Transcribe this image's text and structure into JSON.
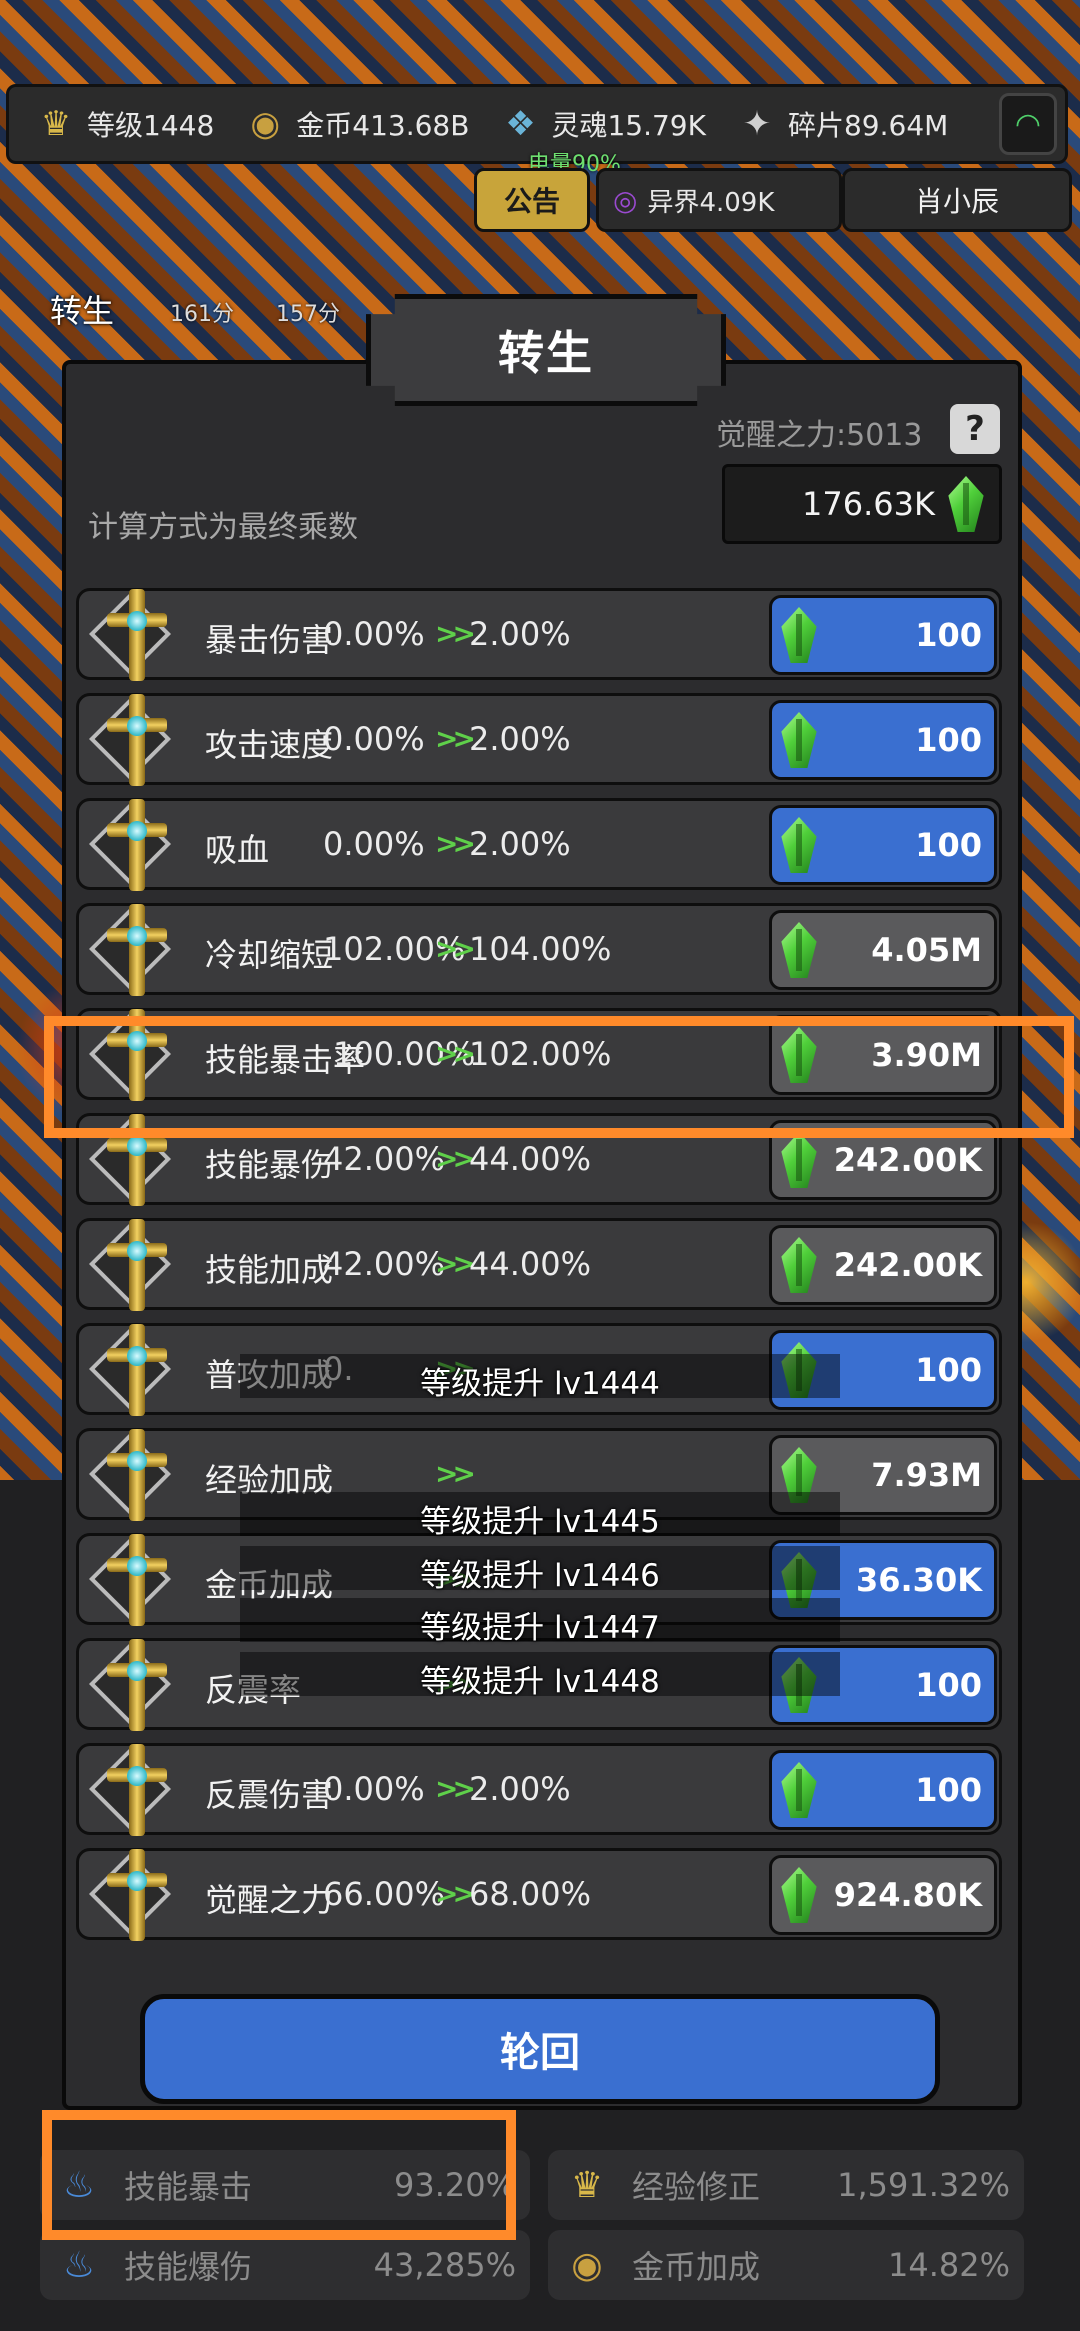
{
  "topbar": {
    "level": "等级1448",
    "gold": "金币413.68B",
    "soul": "灵魂15.79K",
    "shard": "碎片89.64M"
  },
  "battery": "电量90%",
  "notice_label": "公告",
  "otherworld": "异界4.09K",
  "player_name": "肖小辰",
  "side_label": "转生",
  "time_a": "161分",
  "time_b": "157分",
  "panel": {
    "title": "转生",
    "awaken_power": "觉醒之力:5013",
    "help": "?",
    "calc_note": "计算方式为最终乘数",
    "balance": "176.63K"
  },
  "rows": [
    {
      "name": "暴击伤害",
      "current": "0.00%",
      "next": "2.00%",
      "cost": "100",
      "style": "blue"
    },
    {
      "name": "攻击速度",
      "current": "0.00%",
      "next": "2.00%",
      "cost": "100",
      "style": "blue"
    },
    {
      "name": "吸血",
      "current": "0.00%",
      "next": "2.00%",
      "cost": "100",
      "style": "blue"
    },
    {
      "name": "冷却缩短",
      "current": "102.00%",
      "next": "104.00%",
      "cost": "4.05M",
      "style": "grey"
    },
    {
      "name": "技能暴击率",
      "current": "100.00%",
      "next": "102.00%",
      "cost": "3.90M",
      "style": "grey"
    },
    {
      "name": "技能暴伤",
      "current": "42.00%",
      "next": "44.00%",
      "cost": "242.00K",
      "style": "grey"
    },
    {
      "name": "技能加成",
      "current": "42.00%",
      "next": "44.00%",
      "cost": "242.00K",
      "style": "grey"
    },
    {
      "name": "普攻加成",
      "current": "0.",
      "next": "",
      "cost": "100",
      "style": "blue"
    },
    {
      "name": "经验加成",
      "current": "",
      "next": "",
      "cost": "7.93M",
      "style": "grey"
    },
    {
      "name": "金币加成",
      "current": "",
      "next": "",
      "cost": "36.30K",
      "style": "blue"
    },
    {
      "name": "反震率",
      "current": "",
      "next": "",
      "cost": "100",
      "style": "blue"
    },
    {
      "name": "反震伤害",
      "current": "0.00%",
      "next": "2.00%",
      "cost": "100",
      "style": "blue"
    },
    {
      "name": "觉醒之力",
      "current": "66.00%",
      "next": "68.00%",
      "cost": "924.80K",
      "style": "grey"
    }
  ],
  "levelups": [
    "等级提升 lv1444",
    "等级提升 lv1445",
    "等级提升 lv1446",
    "等级提升 lv1447",
    "等级提升 lv1448"
  ],
  "reincarnate_label": "轮回",
  "stats": [
    {
      "label": "技能暴击",
      "value": "93.20%",
      "icon": "fire-icon"
    },
    {
      "label": "经验修正",
      "value": "1,591.32%",
      "icon": "crown-icon"
    },
    {
      "label": "技能爆伤",
      "value": "43,285%",
      "icon": "fire-icon"
    },
    {
      "label": "金币加成",
      "value": "14.82%",
      "icon": "coin-icon"
    }
  ],
  "colors": {
    "highlight": "#ff8a2a",
    "cost_blue": "#3a6fd0",
    "cost_grey": "#5a5a5c",
    "gem_green": "#4fcf3a"
  }
}
